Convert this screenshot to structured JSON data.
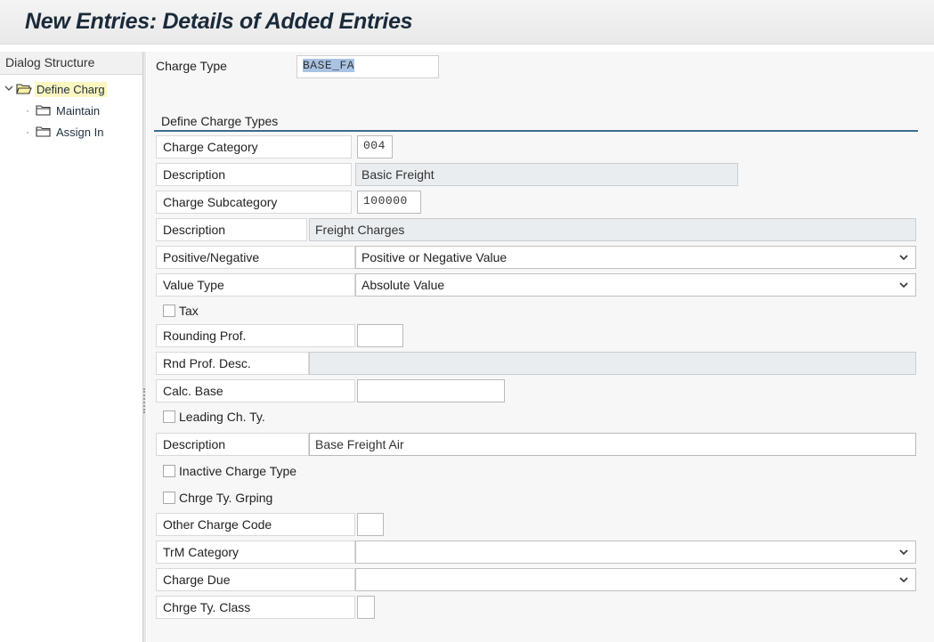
{
  "window": {
    "title": "New Entries: Details of Added Entries"
  },
  "dialog_structure": {
    "header": "Dialog Structure",
    "items": [
      {
        "label": "Define Charg",
        "selected": true,
        "expanded": true
      },
      {
        "label": "Maintain"
      },
      {
        "label": "Assign In"
      }
    ]
  },
  "header_field": {
    "label": "Charge Type",
    "value": "BASE_FA"
  },
  "section": {
    "title": "Define Charge Types"
  },
  "fields": {
    "charge_category": {
      "label": "Charge Category",
      "value": "004"
    },
    "category_description": {
      "label": "Description",
      "value": "Basic Freight"
    },
    "charge_subcategory": {
      "label": "Charge Subcategory",
      "value": "100000"
    },
    "subcategory_description": {
      "label": "Description",
      "value": "Freight Charges"
    },
    "positive_negative": {
      "label": "Positive/Negative",
      "value": "Positive or Negative Value"
    },
    "value_type": {
      "label": "Value Type",
      "value": "Absolute Value"
    },
    "tax": {
      "label": "Tax",
      "checked": false
    },
    "rounding_prof": {
      "label": "Rounding Prof.",
      "value": ""
    },
    "rnd_prof_desc": {
      "label": "Rnd Prof. Desc.",
      "value": ""
    },
    "calc_base": {
      "label": "Calc. Base",
      "value": ""
    },
    "leading_ch_ty": {
      "label": "Leading Ch. Ty.",
      "checked": false
    },
    "description": {
      "label": "Description",
      "value": "Base Freight Air"
    },
    "inactive_charge_type": {
      "label": "Inactive Charge Type",
      "checked": false
    },
    "chrge_ty_grping": {
      "label": "Chrge Ty. Grping",
      "checked": false
    },
    "other_charge_code": {
      "label": "Other Charge Code",
      "value": ""
    },
    "trm_category": {
      "label": "TrM Category",
      "value": ""
    },
    "charge_due": {
      "label": "Charge Due",
      "value": ""
    },
    "chrge_ty_class": {
      "label": "Chrge Ty. Class",
      "value": ""
    }
  },
  "icons": {
    "tree_expand": "chevron-down-icon",
    "tree_folder_open": "folder-open-icon",
    "tree_folder": "folder-icon",
    "dropdown": "chevron-down-icon"
  },
  "colors": {
    "section_line": "#3b6d8c",
    "selected_tree_bg": "#fcf6c0",
    "selection_highlight": "#a9c3e4",
    "readonly_field_bg": "#e9edf0"
  }
}
